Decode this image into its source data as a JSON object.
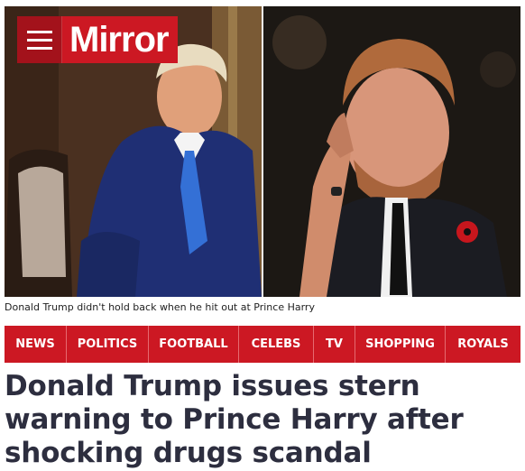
{
  "brand": {
    "name": "Mirror",
    "accent": "#cc1823",
    "menu_icon": "hamburger-menu-icon"
  },
  "hero": {
    "caption": "Donald Trump didn't hold back when he hit out at Prince Harry"
  },
  "nav": {
    "items": [
      "NEWS",
      "POLITICS",
      "FOOTBALL",
      "CELEBS",
      "TV",
      "SHOPPING",
      "ROYALS"
    ]
  },
  "article": {
    "headline": "Donald Trump issues stern warning to Prince Harry after shocking drugs scandal"
  }
}
